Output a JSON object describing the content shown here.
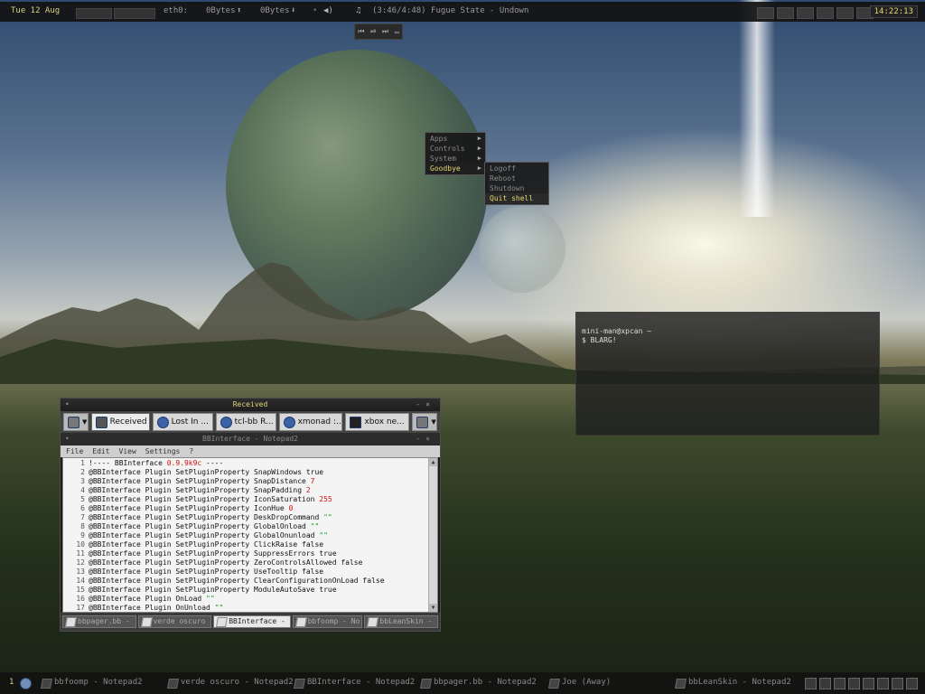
{
  "topbar": {
    "date": "Tue 12 Aug",
    "net_iface": "eth0:",
    "down_rate": "0Bytes",
    "up_rate": "0Bytes",
    "media_info": "(3:46/4:48) Fugue State - Undown",
    "clock": "14:22:13"
  },
  "root_menu": {
    "items": [
      {
        "label": "Apps"
      },
      {
        "label": "Controls"
      },
      {
        "label": "System"
      },
      {
        "label": "Goodbye"
      }
    ],
    "submenu": [
      {
        "label": "Logoff"
      },
      {
        "label": "Reboot"
      },
      {
        "label": "Shutdown"
      },
      {
        "label": "Quit shell"
      }
    ]
  },
  "terminal": {
    "prompt_user": "mini-man@xpcan ~",
    "command": "$ BLARG!"
  },
  "received_window": {
    "title": "Received",
    "tabs": [
      {
        "label": "Received"
      },
      {
        "label": "Lost In ..."
      },
      {
        "label": "tcl-bb R..."
      },
      {
        "label": "xmonad :..."
      },
      {
        "label": "xbox ne..."
      }
    ]
  },
  "notepad": {
    "title": "BBInterface - Notepad2",
    "menu": [
      "File",
      "Edit",
      "View",
      "Settings",
      "?"
    ],
    "lines": [
      {
        "n": "1",
        "text": "!---- BBInterface ",
        "val": "0.9.9k9c",
        "tail": " ----",
        "cls": "red"
      },
      {
        "n": "2",
        "text": "@BBInterface Plugin SetPluginProperty SnapWindows true",
        "val": "",
        "tail": "",
        "cls": ""
      },
      {
        "n": "3",
        "text": "@BBInterface Plugin SetPluginProperty SnapDistance ",
        "val": "7",
        "tail": "",
        "cls": "red"
      },
      {
        "n": "4",
        "text": "@BBInterface Plugin SetPluginProperty SnapPadding ",
        "val": "2",
        "tail": "",
        "cls": "red"
      },
      {
        "n": "5",
        "text": "@BBInterface Plugin SetPluginProperty IconSaturation ",
        "val": "255",
        "tail": "",
        "cls": "red"
      },
      {
        "n": "6",
        "text": "@BBInterface Plugin SetPluginProperty IconHue ",
        "val": "0",
        "tail": "",
        "cls": "red"
      },
      {
        "n": "7",
        "text": "@BBInterface Plugin SetPluginProperty DeskDropCommand ",
        "val": "\"\"",
        "tail": "",
        "cls": "green"
      },
      {
        "n": "8",
        "text": "@BBInterface Plugin SetPluginProperty GlobalOnload ",
        "val": "\"\"",
        "tail": "",
        "cls": "green"
      },
      {
        "n": "9",
        "text": "@BBInterface Plugin SetPluginProperty GlobalOnunload ",
        "val": "\"\"",
        "tail": "",
        "cls": "green"
      },
      {
        "n": "10",
        "text": "@BBInterface Plugin SetPluginProperty ClickRaise false",
        "val": "",
        "tail": "",
        "cls": ""
      },
      {
        "n": "11",
        "text": "@BBInterface Plugin SetPluginProperty SuppressErrors true",
        "val": "",
        "tail": "",
        "cls": ""
      },
      {
        "n": "12",
        "text": "@BBInterface Plugin SetPluginProperty ZeroControlsAllowed false",
        "val": "",
        "tail": "",
        "cls": ""
      },
      {
        "n": "13",
        "text": "@BBInterface Plugin SetPluginProperty UseTooltip false",
        "val": "",
        "tail": "",
        "cls": ""
      },
      {
        "n": "14",
        "text": "@BBInterface Plugin SetPluginProperty ClearConfigurationOnLoad false",
        "val": "",
        "tail": "",
        "cls": ""
      },
      {
        "n": "15",
        "text": "@BBInterface Plugin SetPluginProperty ModuleAutoSave true",
        "val": "",
        "tail": "",
        "cls": ""
      },
      {
        "n": "16",
        "text": "@BBInterface Plugin OnLoad ",
        "val": "\"\"",
        "tail": "",
        "cls": "green"
      },
      {
        "n": "17",
        "text": "@BBInterface Plugin OnUnload ",
        "val": "\"\"",
        "tail": "",
        "cls": "green"
      }
    ],
    "file_tabs": [
      {
        "label": "bbpager.bb - ..."
      },
      {
        "label": "verde oscuro ..."
      },
      {
        "label": "BBInterface - ..."
      },
      {
        "label": "bbfoomp - No..."
      },
      {
        "label": "bbLeanSkin - ..."
      }
    ]
  },
  "taskbar": {
    "workspace": "1",
    "tasks": [
      {
        "label": "bbfoomp - Notepad2"
      },
      {
        "label": "verde oscuro - Notepad2"
      },
      {
        "label": "BBInterface - Notepad2"
      },
      {
        "label": "bbpager.bb - Notepad2"
      },
      {
        "label": "Joe (Away)"
      },
      {
        "label": "bbLeanSkin - Notepad2"
      }
    ]
  }
}
